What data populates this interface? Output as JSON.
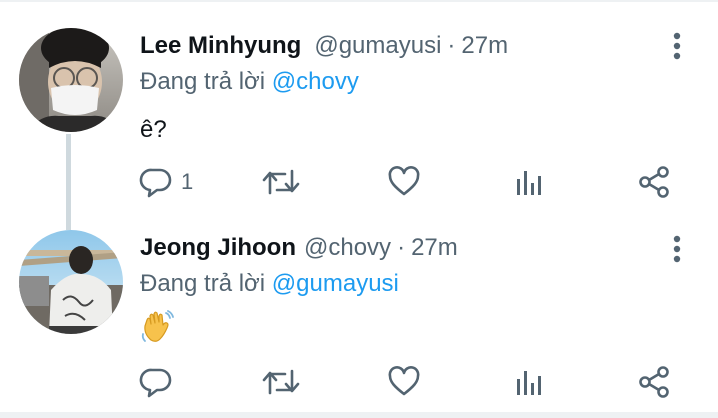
{
  "tweets": [
    {
      "display_name": "Lee Minhyung",
      "handle": "@gumayusi",
      "separator": "·",
      "time": "27m",
      "reply_prefix": "Đang trả lời",
      "reply_to": "@chovy",
      "text": "ê?",
      "reply_count": "1",
      "avatar_icon": "avatar-photo-icon"
    },
    {
      "display_name": "Jeong Jihoon",
      "handle": "@chovy",
      "separator": "·",
      "time": "27m",
      "reply_prefix": "Đang trả lời",
      "reply_to": "@gumayusi",
      "text_emoji": "waving-hand-emoji",
      "reply_count": "",
      "avatar_icon": "avatar-photo-icon"
    }
  ],
  "icons": {
    "more": "more-vertical-icon",
    "reply": "reply-icon",
    "retweet": "retweet-icon",
    "like": "heart-icon",
    "views": "views-icon",
    "share": "share-icon"
  },
  "colors": {
    "text_primary": "#0f1419",
    "text_secondary": "#536471",
    "accent": "#1d9bf0",
    "divider": "#eef1f3",
    "thread_line": "#cfd9de"
  }
}
